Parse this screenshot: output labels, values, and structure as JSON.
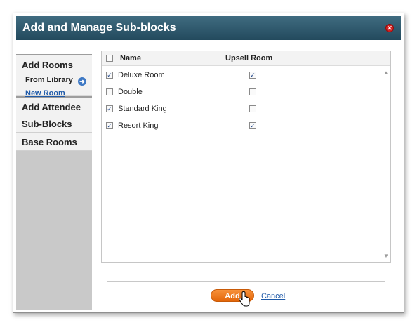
{
  "dialog": {
    "title": "Add and Manage Sub-blocks",
    "close_icon": "close-icon"
  },
  "sidebar": {
    "add_rooms": "Add Rooms",
    "from_library": "From Library",
    "new_room": "New Room",
    "items": [
      {
        "label": "Add Attendee"
      },
      {
        "label": "Sub-Blocks"
      },
      {
        "label": "Base Rooms"
      }
    ]
  },
  "table": {
    "headers": {
      "name": "Name",
      "upsell": "Upsell Room"
    },
    "rows": [
      {
        "name": "Deluxe Room",
        "checked": true,
        "upsell": true
      },
      {
        "name": "Double",
        "checked": false,
        "upsell": false
      },
      {
        "name": "Standard King",
        "checked": true,
        "upsell": false
      },
      {
        "name": "Resort King",
        "checked": true,
        "upsell": true
      }
    ]
  },
  "footer": {
    "add_label": "Add",
    "cancel_label": "Cancel"
  },
  "colors": {
    "titlebar": "#2f5a6e",
    "accent_button": "#f07c1e",
    "link": "#1f5aa8"
  }
}
